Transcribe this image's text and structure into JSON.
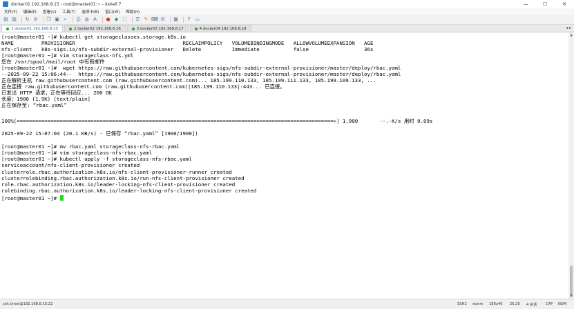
{
  "window": {
    "title": "docker01 192.168.8.15 - root@master01:~ - Xshell 7",
    "minimize": "—",
    "maximize": "☐",
    "close": "✕"
  },
  "menu": {
    "items": [
      "文件(F)",
      "编辑(E)",
      "查看(V)",
      "工具(T)",
      "选项卡(B)",
      "窗口(W)",
      "帮助(H)"
    ]
  },
  "tabs": [
    {
      "label": "1 docker01 192.168.8.15",
      "active": true,
      "color": "#2a9d3a"
    },
    {
      "label": "2 docker02 192.168.8.16",
      "active": false,
      "color": "#2a9d3a"
    },
    {
      "label": "3 docker03 192.168.8.17",
      "active": false,
      "color": "#2a9d3a"
    },
    {
      "label": "4 docker04 192.168.8.18",
      "active": false,
      "color": "#2a9d3a"
    }
  ],
  "terminal": {
    "lines": [
      "[root@master01 ~]# kubectl get storageclasses.storage.k8s.io",
      "NAME         PROVISIONER                                   RECLAIMPOLICY   VOLUMEBINDINGMODE   ALLOWVOLUMEEXPANSION   AGE",
      "nfs-client   k8s-sigs.io/nfs-subdir-external-provisioner   Delete          Immediate           false                  36s",
      "[root@master01 ~]# vim storageclass-nfs.yml",
      "您在 /var/spool/mail/root 中有新邮件",
      "[root@master01 ~]#  wget https://raw.githubusercontent.com/kubernetes-sigs/nfs-subdir-external-provisioner/master/deploy/rbac.yaml",
      "--2025-09-22 15:06:44--  https://raw.githubusercontent.com/kubernetes-sigs/nfs-subdir-external-provisioner/master/deploy/rbac.yaml",
      "正在解析主机 raw.githubusercontent.com (raw.githubusercontent.com)... 185.199.110.133, 185.199.111.133, 185.199.109.133, ...",
      "正在连接 raw.githubusercontent.com (raw.githubusercontent.com)|185.199.110.133|:443... 已连接。",
      "已发出 HTTP 请求，正在等待回应... 200 OK",
      "长度：1900 (1.9K) [text/plain]",
      "正在保存至: “rbac.yaml”",
      "",
      "100%[=======================================================================================================>] 1,900       --.-K/s 用时 0.09s",
      "",
      "2025-09-22 15:07:04 (20.1 KB/s) - 已保存 “rbac.yaml” [1900/1900])",
      "",
      "[root@master01 ~]# mv rbac.yaml storageclass-nfs-rbac.yaml",
      "[root@master01 ~]# vim storageclass-nfs-rbac.yaml",
      "[root@master01 ~]# kubectl apply -f storageclass-nfs-rbac.yaml",
      "serviceaccount/nfs-client-provisioner created",
      "clusterrole.rbac.authorization.k8s.io/nfs-client-provisioner-runner created",
      "clusterrolebinding.rbac.authorization.k8s.io/run-nfs-client-provisioner created",
      "role.rbac.authorization.k8s.io/leader-locking-nfs-client-provisioner created",
      "rolebinding.rbac.authorization.k8s.io/leader-locking-nfs-client-provisioner created",
      "[root@master01 ~]# "
    ],
    "cursor_color": "#22dd22"
  },
  "status": {
    "connection": "ssh://root@192.168.8.15:22",
    "protocol": "SSH2",
    "term": "xterm",
    "size": "180x40",
    "position": "26,20",
    "sessions": "4 会话",
    "cap": "CAP",
    "num": "NUM"
  }
}
